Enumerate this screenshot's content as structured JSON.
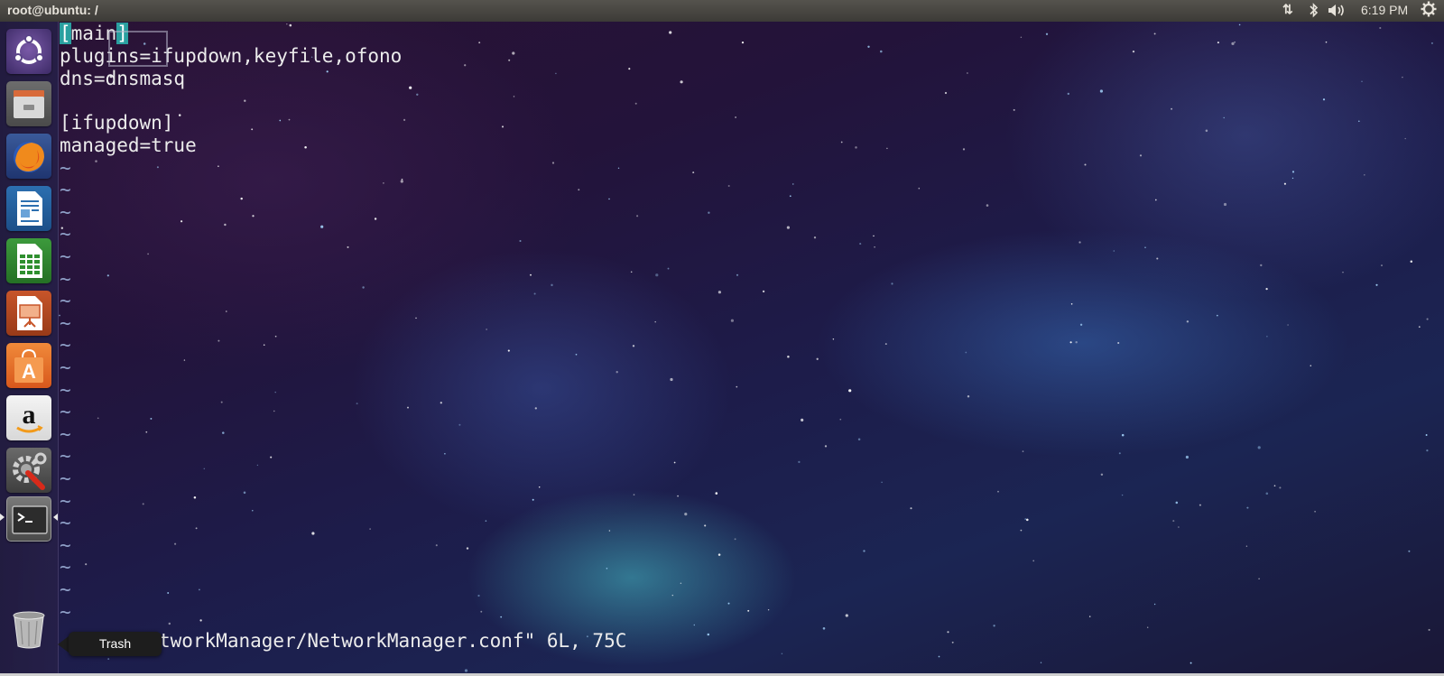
{
  "top_panel": {
    "window_title": "root@ubuntu: /",
    "clock": "6:19 PM",
    "network_icon": "⇅",
    "bluetooth_icon": "✱",
    "volume_icon": "🔈",
    "session_icon": "⚙"
  },
  "launcher": {
    "items": [
      {
        "name": "dash-home",
        "icon": "ubuntu-logo-icon"
      },
      {
        "name": "files",
        "icon": "file-cabinet-icon"
      },
      {
        "name": "firefox",
        "icon": "firefox-icon"
      },
      {
        "name": "libreoffice-writer",
        "icon": "writer-document-icon"
      },
      {
        "name": "libreoffice-calc",
        "icon": "calc-spreadsheet-icon"
      },
      {
        "name": "libreoffice-impress",
        "icon": "impress-presentation-icon"
      },
      {
        "name": "ubuntu-software",
        "icon": "shopping-bag-icon"
      },
      {
        "name": "amazon",
        "icon": "amazon-icon"
      },
      {
        "name": "system-settings",
        "icon": "settings-wrench-icon"
      },
      {
        "name": "terminal",
        "icon": "terminal-icon"
      },
      {
        "name": "trash",
        "icon": "trash-icon"
      }
    ],
    "tooltip": "Trash"
  },
  "editor": {
    "line_1_open": "[",
    "line_1_word": "mai",
    "line_1_cursor_char": "n",
    "line_1_close": "]",
    "lines": [
      "plugins=ifupdown,keyfile,ofono",
      "dns=dnsmasq",
      "",
      "[ifupdown]",
      "managed=true"
    ],
    "tilde": "~",
    "status_line": "\"/etc/NetworkManager/NetworkManager.conf\" 6L, 75C",
    "status_visible": "tworkManager/NetworkManager.conf\" 6L, 75C"
  },
  "colors": {
    "panel": "#3c3b37",
    "highlight": "#2aa0a0",
    "text": "#ececec"
  }
}
